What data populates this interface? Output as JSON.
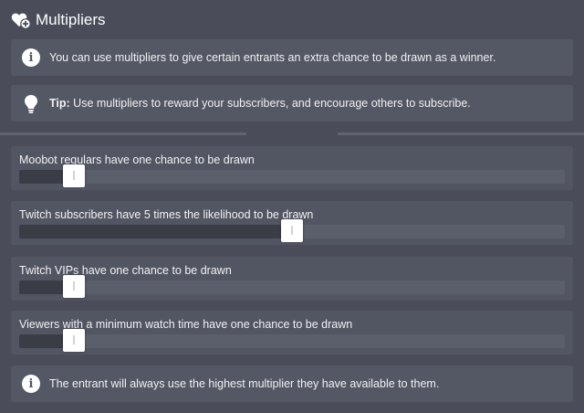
{
  "header": {
    "title": "Multipliers",
    "icon": "heart-plus-icon"
  },
  "info_box": {
    "icon": "info-icon",
    "text": "You can use multipliers to give certain entrants an extra chance to be drawn as a winner."
  },
  "tip_box": {
    "icon": "lightbulb-icon",
    "label": "Tip:",
    "text": " Use multipliers to reward your subscribers, and encourage others to subscribe."
  },
  "sliders": [
    {
      "label": "Moobot regulars have one chance to be drawn",
      "value_fraction": 0.1
    },
    {
      "label": "Twitch subscribers have 5 times the likelihood to be drawn",
      "value_fraction": 0.5
    },
    {
      "label": "Twitch VIPs have one chance to be drawn",
      "value_fraction": 0.1
    },
    {
      "label": "Viewers with a minimum watch time have one chance to be drawn",
      "value_fraction": 0.1
    }
  ],
  "footer_box": {
    "icon": "info-icon",
    "text": "The entrant will always use the highest multiplier they have available to them."
  },
  "colors": {
    "background": "#4a4d59",
    "panel": "#545764",
    "slider_fill": "#3a3c46",
    "slider_track": "#5b5e6b",
    "handle": "#ffffff"
  }
}
